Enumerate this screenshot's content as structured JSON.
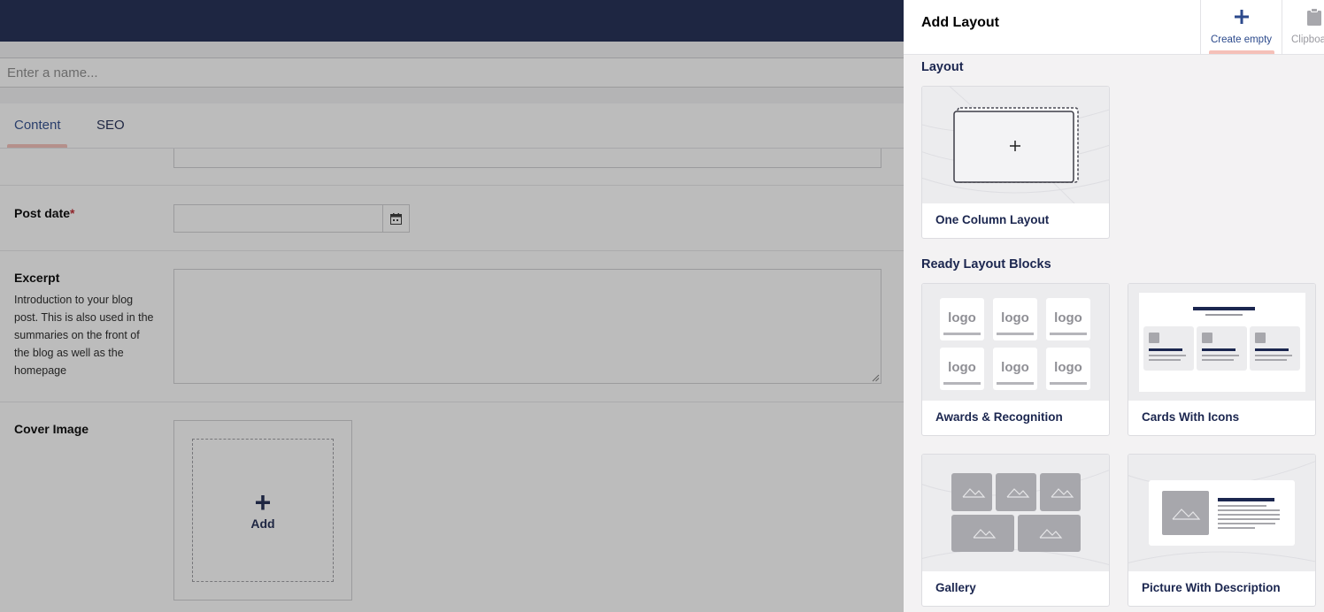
{
  "editor": {
    "name_placeholder": "Enter a name...",
    "tabs": [
      {
        "label": "Content",
        "active": true
      },
      {
        "label": "SEO",
        "active": false
      }
    ],
    "fields": {
      "post_date": {
        "label": "Post date",
        "required_mark": "*"
      },
      "excerpt": {
        "label": "Excerpt",
        "description": "Introduction to your blog post. This is also used in the summaries on the front of the blog as well as the homepage"
      },
      "cover_image": {
        "label": "Cover Image",
        "add_icon": "plus-icon",
        "add_label": "Add"
      }
    }
  },
  "panel": {
    "title": "Add Layout",
    "actions": [
      {
        "label": "Create empty",
        "icon": "plus-icon"
      },
      {
        "label": "Clipboard",
        "icon": "clipboard-icon"
      }
    ],
    "sections": {
      "layout": {
        "title": "Layout",
        "items": [
          {
            "label": "One Column Layout"
          }
        ]
      },
      "ready": {
        "title": "Ready Layout Blocks",
        "items": [
          {
            "label": "Awards & Recognition",
            "thumb_text": "logo"
          },
          {
            "label": "Cards With Icons"
          },
          {
            "label": "Gallery"
          },
          {
            "label": "Picture With Description"
          }
        ]
      }
    }
  },
  "colors": {
    "navy": "#1b264f",
    "accent": "#2c4a8c",
    "tab_highlight": "#f5c0b8",
    "required": "#c0262d"
  }
}
